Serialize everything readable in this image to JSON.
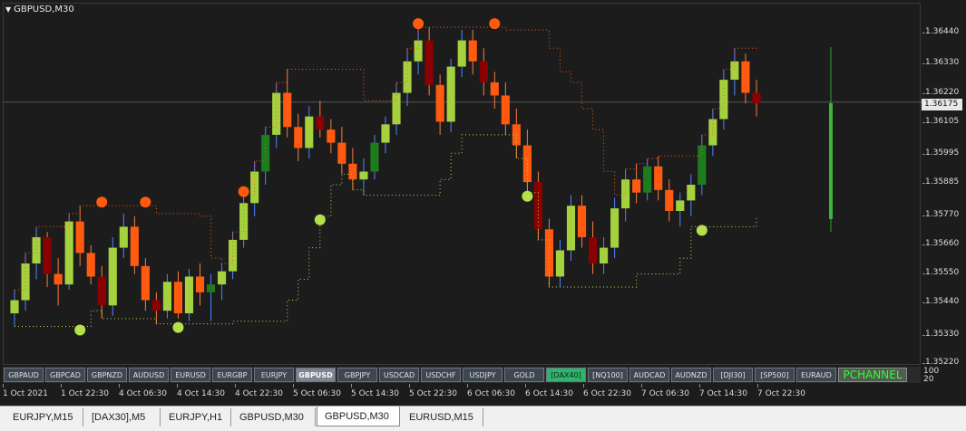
{
  "window": {
    "title": "GBPUSD,M30"
  },
  "colors": {
    "background": "#1c1c1c",
    "bull": "#a4d13d",
    "bull_dark": "#1d7d1d",
    "bear": "#ff5a10",
    "bear_dark": "#8b0000",
    "wick_bull": "#4f84ff",
    "wick_bear": "#ff7a3d",
    "upper_line": "#ff5a10",
    "lower_line": "#b4e04a",
    "accent": "#2fb56b",
    "pchannel_text": "#33ff33"
  },
  "price_axis": {
    "ticks": [
      "1.36440",
      "1.36330",
      "1.36220",
      "1.36105",
      "1.35995",
      "1.35885",
      "1.35770",
      "1.35660",
      "1.35550",
      "1.35440",
      "1.35330",
      "1.35220"
    ],
    "current_price": "1.36175"
  },
  "time_axis": {
    "ticks": [
      "1 Oct 2021",
      "1 Oct 22:30",
      "4 Oct 06:30",
      "4 Oct 14:30",
      "4 Oct 22:30",
      "5 Oct 06:30",
      "5 Oct 14:30",
      "5 Oct 22:30",
      "6 Oct 06:30",
      "6 Oct 14:30",
      "6 Oct 22:30",
      "7 Oct 06:30",
      "7 Oct 14:30",
      "7 Oct 22:30"
    ]
  },
  "symbol_bar": {
    "buttons": [
      "GBPAUD",
      "GBPCAD",
      "GBPNZD",
      "AUDUSD",
      "EURUSD",
      "EURGBP",
      "EURJPY",
      "GBPUSD",
      "GBPJPY",
      "USDCAD",
      "USDCHF",
      "USDJPY",
      "GOLD",
      "[DAX40]",
      "[NQ100]",
      "AUDCAD",
      "AUDNZD",
      "[DJI30]",
      "[SP500]",
      "EURAUD"
    ],
    "active": "GBPUSD",
    "highlighted": "[DAX40]",
    "pchannel_label": "PCHANNEL",
    "indicator_levels": [
      "100",
      "20"
    ]
  },
  "tabs": [
    "EURJPY,M15",
    "[DAX30],M5",
    "EURJPY,H1",
    "GBPUSD,M30",
    "GBPUSD,M30",
    "EURUSD,M15"
  ],
  "active_tab": "GBPUSD,M30",
  "chart_data": {
    "type": "candlestick",
    "symbol": "GBPUSD",
    "timeframe": "M30",
    "ylim": [
      1.3517,
      1.3655
    ],
    "candles": [
      [
        1.3537,
        1.3546,
        1.3532,
        1.3542
      ],
      [
        1.3542,
        1.356,
        1.3538,
        1.3556
      ],
      [
        1.3556,
        1.357,
        1.355,
        1.3566
      ],
      [
        1.3566,
        1.3568,
        1.3547,
        1.3552
      ],
      [
        1.3552,
        1.3558,
        1.354,
        1.3548
      ],
      [
        1.3548,
        1.3575,
        1.3546,
        1.3572
      ],
      [
        1.3572,
        1.3578,
        1.3555,
        1.356
      ],
      [
        1.356,
        1.3563,
        1.3548,
        1.3551
      ],
      [
        1.3551,
        1.3555,
        1.3535,
        1.354
      ],
      [
        1.354,
        1.3566,
        1.3536,
        1.3562
      ],
      [
        1.3562,
        1.3575,
        1.3558,
        1.357
      ],
      [
        1.357,
        1.3574,
        1.3552,
        1.3555
      ],
      [
        1.3555,
        1.3558,
        1.3538,
        1.3542
      ],
      [
        1.3542,
        1.3545,
        1.3533,
        1.3538
      ],
      [
        1.3538,
        1.3552,
        1.3535,
        1.3549
      ],
      [
        1.3549,
        1.3553,
        1.3535,
        1.3537
      ],
      [
        1.3537,
        1.3554,
        1.3534,
        1.3551
      ],
      [
        1.3551,
        1.3556,
        1.354,
        1.3545
      ],
      [
        1.3545,
        1.3552,
        1.3534,
        1.3548
      ],
      [
        1.3548,
        1.3556,
        1.3542,
        1.3553
      ],
      [
        1.3553,
        1.3568,
        1.355,
        1.3565
      ],
      [
        1.3565,
        1.3582,
        1.3562,
        1.3579
      ],
      [
        1.3579,
        1.3595,
        1.3574,
        1.3591
      ],
      [
        1.3591,
        1.3608,
        1.3586,
        1.3605
      ],
      [
        1.3605,
        1.3625,
        1.36,
        1.3621
      ],
      [
        1.3621,
        1.363,
        1.3604,
        1.3608
      ],
      [
        1.3608,
        1.3613,
        1.3595,
        1.36
      ],
      [
        1.36,
        1.3616,
        1.3596,
        1.3612
      ],
      [
        1.3612,
        1.3618,
        1.3604,
        1.3607
      ],
      [
        1.3607,
        1.3611,
        1.3598,
        1.3602
      ],
      [
        1.3602,
        1.3608,
        1.359,
        1.3594
      ],
      [
        1.3594,
        1.36,
        1.3584,
        1.3588
      ],
      [
        1.3588,
        1.3596,
        1.3582,
        1.3591
      ],
      [
        1.3591,
        1.3605,
        1.3588,
        1.3602
      ],
      [
        1.3602,
        1.3612,
        1.3598,
        1.3609
      ],
      [
        1.3609,
        1.3625,
        1.3605,
        1.3621
      ],
      [
        1.3621,
        1.3638,
        1.3616,
        1.3633
      ],
      [
        1.3633,
        1.3646,
        1.3628,
        1.3641
      ],
      [
        1.3641,
        1.3646,
        1.362,
        1.3624
      ],
      [
        1.3624,
        1.3628,
        1.3605,
        1.361
      ],
      [
        1.361,
        1.3634,
        1.3606,
        1.3631
      ],
      [
        1.3631,
        1.3645,
        1.3627,
        1.3641
      ],
      [
        1.3641,
        1.3645,
        1.3628,
        1.3633
      ],
      [
        1.3633,
        1.3638,
        1.362,
        1.3625
      ],
      [
        1.3625,
        1.3629,
        1.3615,
        1.362
      ],
      [
        1.362,
        1.3625,
        1.3605,
        1.3609
      ],
      [
        1.3609,
        1.3615,
        1.3596,
        1.3601
      ],
      [
        1.3601,
        1.3607,
        1.3583,
        1.3587
      ],
      [
        1.3587,
        1.3591,
        1.3565,
        1.3569
      ],
      [
        1.3569,
        1.3573,
        1.3547,
        1.3551
      ],
      [
        1.3551,
        1.3565,
        1.3547,
        1.3561
      ],
      [
        1.3561,
        1.3582,
        1.3557,
        1.3578
      ],
      [
        1.3578,
        1.3582,
        1.3562,
        1.3566
      ],
      [
        1.3566,
        1.3572,
        1.3552,
        1.3556
      ],
      [
        1.3556,
        1.3566,
        1.3552,
        1.3562
      ],
      [
        1.3562,
        1.3581,
        1.3558,
        1.3577
      ],
      [
        1.3577,
        1.3592,
        1.3572,
        1.3588
      ],
      [
        1.3588,
        1.3594,
        1.3579,
        1.3583
      ],
      [
        1.3583,
        1.3596,
        1.358,
        1.3593
      ],
      [
        1.3593,
        1.3597,
        1.358,
        1.3584
      ],
      [
        1.3584,
        1.3588,
        1.3572,
        1.3576
      ],
      [
        1.3576,
        1.3583,
        1.357,
        1.358
      ],
      [
        1.358,
        1.359,
        1.3574,
        1.3586
      ],
      [
        1.3586,
        1.3605,
        1.3582,
        1.3601
      ],
      [
        1.3601,
        1.3615,
        1.3597,
        1.3611
      ],
      [
        1.3611,
        1.363,
        1.3607,
        1.3626
      ],
      [
        1.3626,
        1.3638,
        1.362,
        1.3633
      ],
      [
        1.3633,
        1.3636,
        1.3617,
        1.3621
      ],
      [
        1.3621,
        1.3626,
        1.3612,
        1.3617
      ]
    ],
    "annotations": {
      "upper_channel_start_markers": 5,
      "lower_channel_start_markers": 5
    }
  }
}
